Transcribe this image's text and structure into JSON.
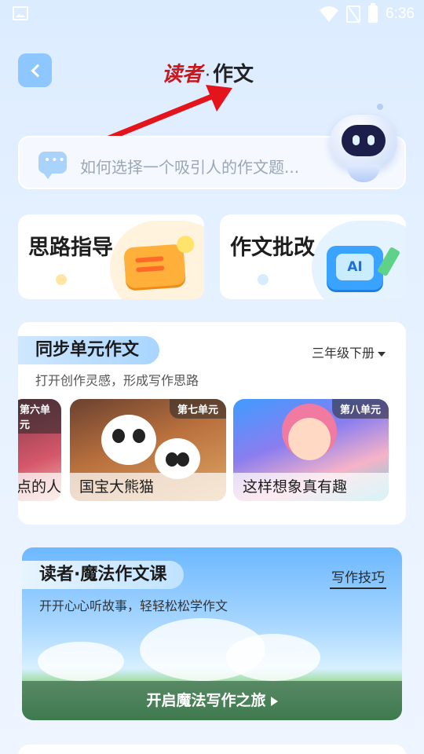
{
  "status_bar": {
    "time": "6:36"
  },
  "header": {
    "brand_part1": "读者",
    "brand_dot": "·",
    "brand_part2": "作文"
  },
  "search": {
    "placeholder": "如何选择一个吸引人的作文题..."
  },
  "features": [
    {
      "label": "思路指导"
    },
    {
      "label": "作文批改",
      "icon_text": "AI"
    }
  ],
  "sync_section": {
    "title": "同步单元作文",
    "grade": "三年级下册",
    "subtitle": "打开创作灵感，形成写作思路",
    "units": [
      {
        "badge": "第六单元",
        "label": "点的人"
      },
      {
        "badge": "第七单元",
        "label": "国宝大熊猫"
      },
      {
        "badge": "第八单元",
        "label": "这样想象真有趣"
      }
    ]
  },
  "magic_section": {
    "title": "读者·魔法作文课",
    "tips": "写作技巧",
    "subtitle": "开开心心听故事，轻轻松松学作文",
    "cta": "开启魔法写作之旅"
  }
}
